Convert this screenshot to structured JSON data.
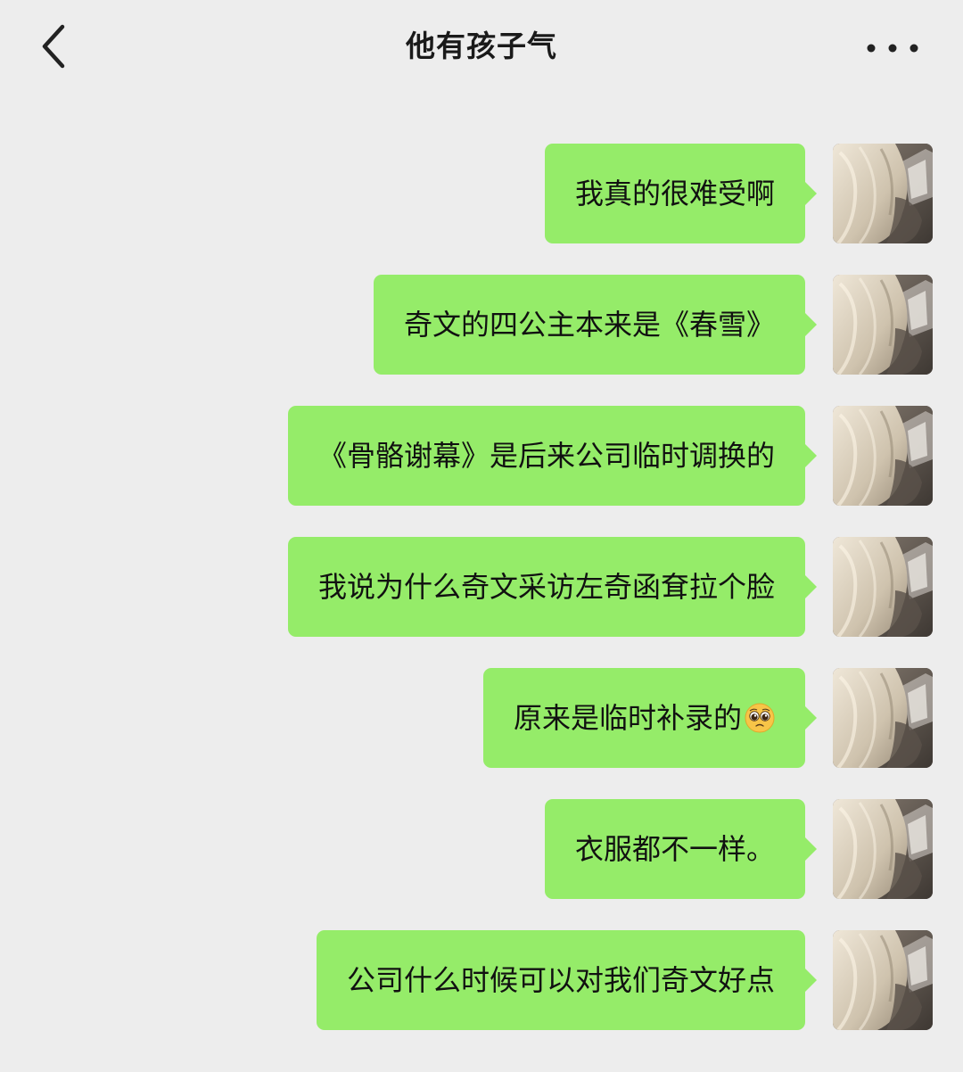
{
  "header": {
    "title": "他有孩子气",
    "back_icon": "chevron-left-icon",
    "more_icon": "more-horizontal-icon"
  },
  "theme": {
    "background": "#ededed",
    "bubble_color": "#95ec69",
    "text_color": "#111111"
  },
  "messages": [
    {
      "text": "我真的很难受啊",
      "sender": "self"
    },
    {
      "text": "奇文的四公主本来是《春雪》",
      "sender": "self"
    },
    {
      "text": "《骨骼谢幕》是后来公司临时调换的",
      "sender": "self"
    },
    {
      "text": "我说为什么奇文采访左奇函耷拉个脸",
      "sender": "self"
    },
    {
      "text": "原来是临时补录的",
      "sender": "self",
      "emoji": "pleading-face-emoji"
    },
    {
      "text": "衣服都不一样。",
      "sender": "self"
    },
    {
      "text": "公司什么时候可以对我们奇文好点",
      "sender": "self"
    }
  ]
}
